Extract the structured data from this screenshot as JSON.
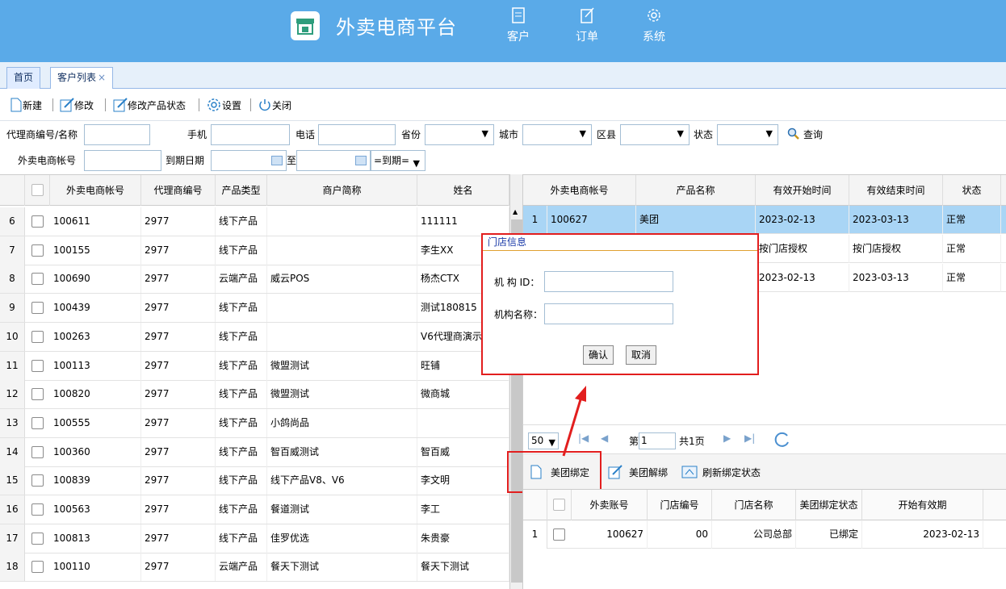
{
  "header": {
    "brand": "外卖电商平台",
    "nav": [
      {
        "label": "客户",
        "icon": "document-icon"
      },
      {
        "label": "订单",
        "icon": "edit-icon"
      },
      {
        "label": "系统",
        "icon": "gear-icon"
      }
    ]
  },
  "tabs": [
    {
      "label": "首页"
    },
    {
      "label": "客户列表",
      "close": "×"
    }
  ],
  "toolbar": {
    "new": "新建",
    "edit": "修改",
    "edit_status": "修改产品状态",
    "settings": "设置",
    "close": "关闭"
  },
  "filters": {
    "agent": "代理商编号/名称",
    "phone": "手机",
    "tel": "电话",
    "province": "省份",
    "city": "城市",
    "district": "区县",
    "status": "状态",
    "query": "查询",
    "account": "外卖电商帐号",
    "expire": "到期日期",
    "to": "至",
    "expire_op": "=到期="
  },
  "left_table": {
    "headers": [
      "外卖电商帐号",
      "代理商编号",
      "产品类型",
      "商户简称",
      "姓名"
    ],
    "rows": [
      {
        "n": "6",
        "account": "100611",
        "agent": "2977",
        "type": "线下产品",
        "shop": "",
        "name": "111111"
      },
      {
        "n": "7",
        "account": "100155",
        "agent": "2977",
        "type": "线下产品",
        "shop": "",
        "name": "李生XX"
      },
      {
        "n": "8",
        "account": "100690",
        "agent": "2977",
        "type": "云端产品",
        "shop": "威云POS",
        "name": "杨杰CTX"
      },
      {
        "n": "9",
        "account": "100439",
        "agent": "2977",
        "type": "线下产品",
        "shop": "",
        "name": "测试180815"
      },
      {
        "n": "10",
        "account": "100263",
        "agent": "2977",
        "type": "线下产品",
        "shop": "",
        "name": "V6代理商演示"
      },
      {
        "n": "11",
        "account": "100113",
        "agent": "2977",
        "type": "线下产品",
        "shop": "微盟测试",
        "name": "旺铺"
      },
      {
        "n": "12",
        "account": "100820",
        "agent": "2977",
        "type": "线下产品",
        "shop": "微盟测试",
        "name": "微商城"
      },
      {
        "n": "13",
        "account": "100555",
        "agent": "2977",
        "type": "线下产品",
        "shop": "小鸽尚品",
        "name": ""
      },
      {
        "n": "14",
        "account": "100360",
        "agent": "2977",
        "type": "线下产品",
        "shop": "智百威测试",
        "name": "智百威"
      },
      {
        "n": "15",
        "account": "100839",
        "agent": "2977",
        "type": "线下产品",
        "shop": "线下产品V8、V6",
        "name": "李文明"
      },
      {
        "n": "16",
        "account": "100563",
        "agent": "2977",
        "type": "线下产品",
        "shop": "餐道测试",
        "name": "李工"
      },
      {
        "n": "17",
        "account": "100813",
        "agent": "2977",
        "type": "线下产品",
        "shop": "佳罗优选",
        "name": "朱贵豪"
      },
      {
        "n": "18",
        "account": "100110",
        "agent": "2977",
        "type": "云端产品",
        "shop": "餐天下测试",
        "name": "餐天下测试"
      }
    ]
  },
  "right_table": {
    "headers": [
      "外卖电商帐号",
      "产品名称",
      "有效开始时间",
      "有效结束时间",
      "状态"
    ],
    "rows": [
      {
        "n": "1",
        "account": "100627",
        "product": "美团",
        "start": "2023-02-13",
        "end": "2023-03-13",
        "status": "正常"
      },
      {
        "n": "",
        "account": "",
        "product": "",
        "start": "按门店授权",
        "end": "按门店授权",
        "status": "正常"
      },
      {
        "n": "",
        "account": "",
        "product": "",
        "start": "2023-02-13",
        "end": "2023-03-13",
        "status": "正常"
      }
    ]
  },
  "pager": {
    "size": "50",
    "page_label": "第",
    "page": "1",
    "total": "共1页"
  },
  "bind_toolbar": {
    "bind": "美团绑定",
    "unbind": "美团解绑",
    "refresh": "刷新绑定状态"
  },
  "bind_table": {
    "headers": [
      "外卖账号",
      "门店编号",
      "门店名称",
      "美团绑定状态",
      "开始有效期"
    ],
    "rows": [
      {
        "n": "1",
        "account": "100627",
        "store_no": "00",
        "store_name": "公司总部",
        "status": "已绑定",
        "start": "2023-02-13"
      }
    ]
  },
  "dialog": {
    "title": "门店信息",
    "org_id": "机 构 ID：",
    "org_name": "机构名称：",
    "ok": "确认",
    "cancel": "取消"
  }
}
